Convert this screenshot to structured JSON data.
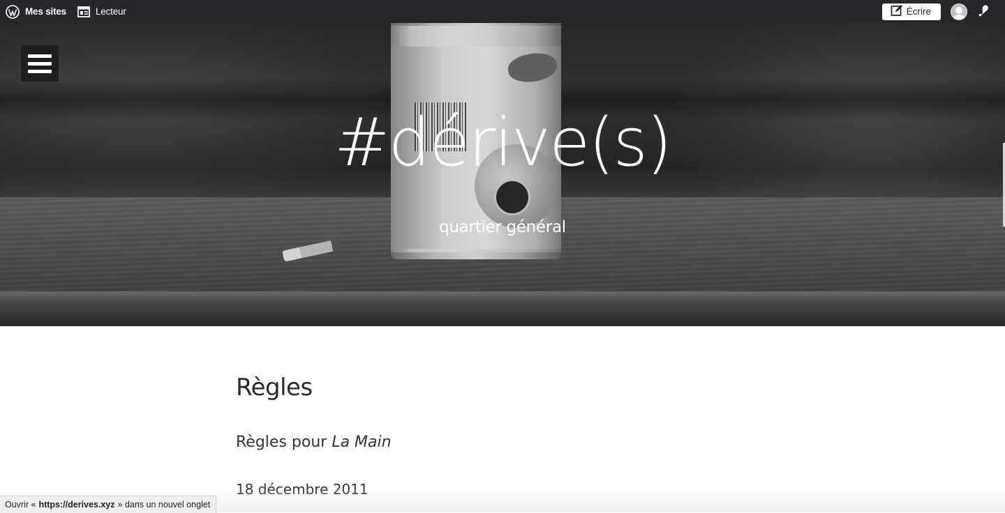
{
  "adminbar": {
    "my_sites": "Mes sites",
    "reader": "Lecteur",
    "write": "Écrire",
    "icons": [
      "wordpress-icon",
      "reader-icon",
      "write-icon",
      "avatar",
      "notifications-icon"
    ]
  },
  "header": {
    "site_title": "#dérive(s)",
    "site_description": "quartier général",
    "menu_icon": "hamburger-menu-icon"
  },
  "page": {
    "title": "Règles",
    "subtitle_prefix": "Règles pour ",
    "subtitle_emphasis": "La Main",
    "date": "18 décembre 2011"
  },
  "statusbar": {
    "prefix": "Ouvrir «",
    "url": "https://derives.xyz",
    "suffix": "» dans un nouvel onglet"
  }
}
